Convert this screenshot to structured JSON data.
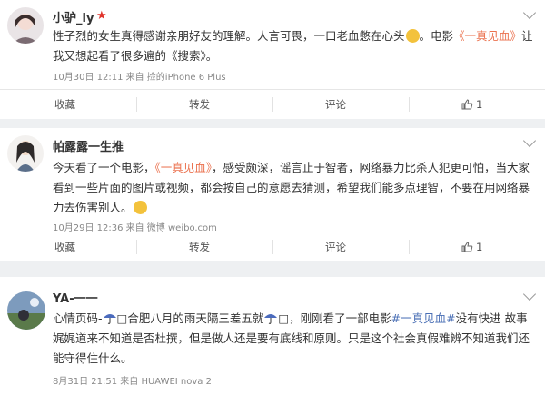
{
  "posts": [
    {
      "username": "小驴_ly",
      "badge_icon": "red-star-icon",
      "text": {
        "t1": "性子烈的女生真得感谢亲朋好友的理解。人言可畏，一口老血憋在心头",
        "t2": "。电影",
        "link": "《一真见血》",
        "t3": "让我又想起看了很多遍的《搜索》。"
      },
      "meta": "10月30日 12:11 来自 捡的iPhone 6 Plus",
      "actions": {
        "favorite": "收藏",
        "repost": "转发",
        "comment": "评论",
        "like": "1"
      }
    },
    {
      "username": "帕露露一生推",
      "text": {
        "t1": "今天看了一个电影，",
        "link": "《一真见血》",
        "t2": "，感受颇深，谣言止于智者，网络暴力比杀人犯更可怕，当大家看到一些片面的图片或视频，都会按自己的意愿去猜测，希望我们能多点理智，不要在用网络暴力去伤害别人。"
      },
      "meta": "10月29日 12:36 来自 微博 weibo.com",
      "actions": {
        "favorite": "收藏",
        "repost": "转发",
        "comment": "评论",
        "like": "1"
      }
    },
    {
      "username": "YA-一一",
      "text": {
        "t1": "心情页码-",
        "t2": "□合肥八月的雨天隔三差五就",
        "t3": "□，刚刚看了一部电影",
        "hashtag": "#一真见血#",
        "t4": "没有快进 故事娓娓道来不知道是否杜撰，但是做人还是要有底线和原则。只是这个社会真假难辨不知道我们还能守得住什么。"
      },
      "meta": "8月31日 21:51 来自 HUAWEI nova 2"
    }
  ],
  "colors": {
    "link": "#eb7350",
    "hashtag": "#4a6fb5",
    "star": "#e0332b",
    "background": "#eef0f2"
  }
}
